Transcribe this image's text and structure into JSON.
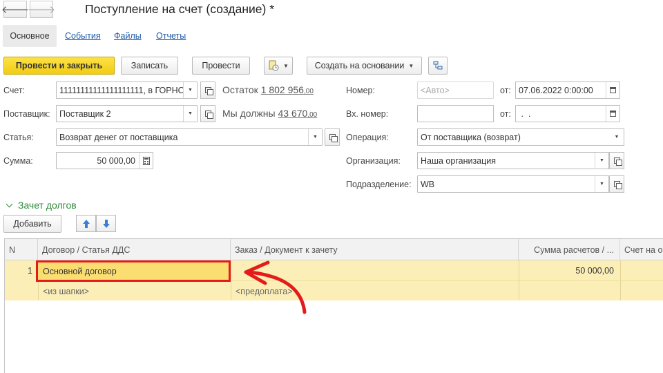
{
  "window": {
    "title": "Поступление на счет (создание) *"
  },
  "nav": {
    "back_icon": "arrow-left-icon",
    "forward_icon": "arrow-right-icon"
  },
  "tabs": [
    {
      "label": "Основное",
      "active": true
    },
    {
      "label": "События"
    },
    {
      "label": "Файлы"
    },
    {
      "label": "Отчеты"
    }
  ],
  "toolbar": {
    "post_and_close": "Провести и закрыть",
    "save": "Записать",
    "post": "Провести",
    "create_based_on": "Создать на основании"
  },
  "form": {
    "account": {
      "label": "Счет:",
      "value": "11111111111111111111, в ГОРНС"
    },
    "balance": {
      "label": "Остаток",
      "int": "1 802 956",
      "dec": ",00"
    },
    "supplier": {
      "label": "Поставщик:",
      "value": "Поставщик 2"
    },
    "we_owe": {
      "label": "Мы должны",
      "int": "43 670",
      "dec": ",00"
    },
    "article": {
      "label": "Статья:",
      "value": "Возврат денег от поставщика"
    },
    "amount": {
      "label": "Сумма:",
      "value": "50 000,00"
    },
    "number": {
      "label": "Номер:",
      "placeholder": "<Авто>"
    },
    "date_from": {
      "label": "от:",
      "value": "07.06.2022  0:00:00"
    },
    "in_number": {
      "label": "Вх. номер:",
      "value": ""
    },
    "in_date_from": {
      "label": "от:",
      "value": " .  ."
    },
    "operation": {
      "label": "Операция:",
      "value": "От поставщика (возврат)"
    },
    "organization": {
      "label": "Организация:",
      "value": "Наша организация"
    },
    "department": {
      "label": "Подразделение:",
      "value": "WB"
    }
  },
  "debts_section": {
    "title": "Зачет долгов",
    "add_button": "Добавить"
  },
  "table": {
    "columns": [
      "N",
      "Договор / Статья ДДС",
      "Заказ / Документ к зачету",
      "Сумма расчетов / ...",
      "Счет на о"
    ],
    "rows": [
      {
        "n": "1",
        "contract": "Основной договор",
        "article": "<из шапки>",
        "order": "",
        "document": "<предоплата>",
        "sum": "50 000,00"
      }
    ]
  },
  "colors": {
    "primary_button": "#f5d01e",
    "highlight_border": "#e41b1b",
    "row_bg": "#fbefb7",
    "section_green": "#2e8b3a"
  }
}
